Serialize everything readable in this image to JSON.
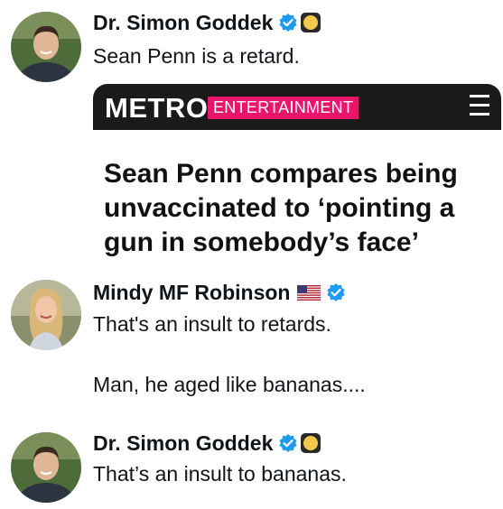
{
  "tweets": [
    {
      "author": "Dr. Simon Goddek",
      "verified": true,
      "affiliate_badge": "gold-circle",
      "text": "Sean Penn is a retard."
    },
    {
      "author": "Mindy MF Robinson",
      "verified": true,
      "flag": "us-flag",
      "text_line1": "That's an insult to retards.",
      "text_line2": "Man, he aged like bananas...."
    },
    {
      "author": "Dr. Simon Goddek",
      "verified": true,
      "affiliate_badge": "gold-circle",
      "text": "That’s an insult to bananas."
    }
  ],
  "embed": {
    "brand": "METRO",
    "section": "ENTERTAINMENT",
    "headline": "Sean Penn compares being unvaccinated to ‘pointing a gun in somebody’s face’",
    "menu_icon": "hamburger-icon"
  },
  "colors": {
    "verified_blue": "#1d9bf0",
    "metro_pink": "#e8156a",
    "metro_bar": "#1a1a1a",
    "gold": "#f2c94c"
  }
}
